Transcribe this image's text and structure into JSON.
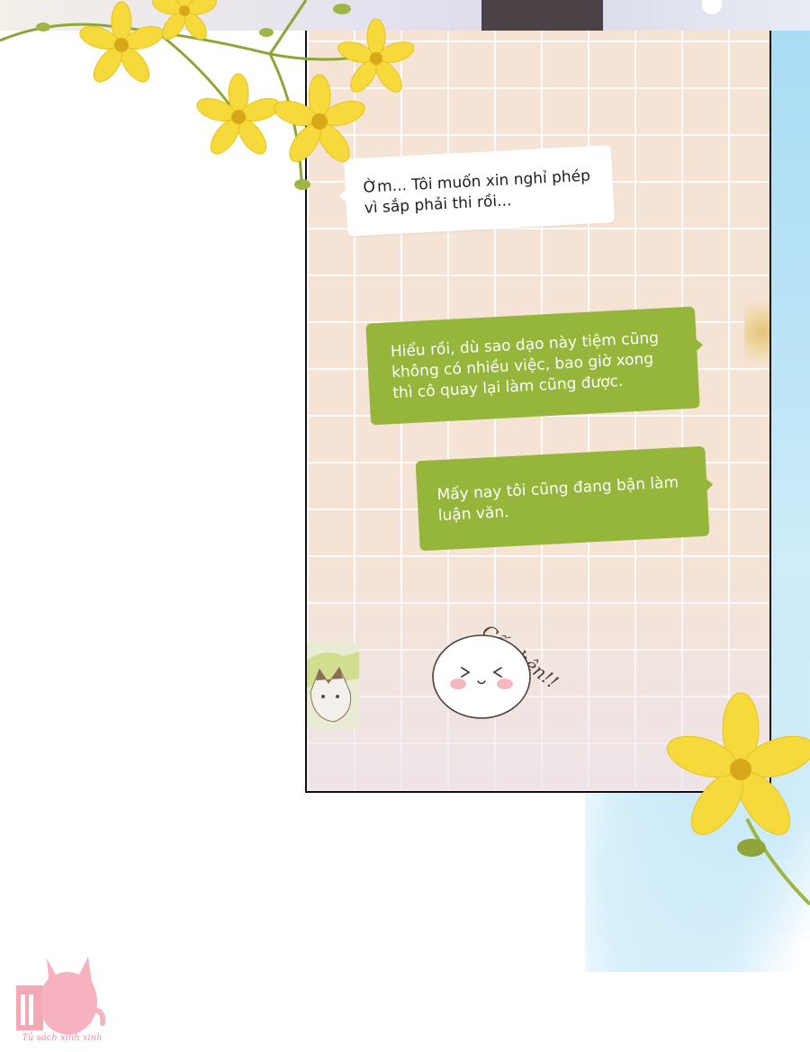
{
  "chat": {
    "messages": [
      {
        "side": "incoming",
        "text": "Ờm... Tôi muốn xin nghỉ phép\nvì sắp phải thi rồi..."
      },
      {
        "side": "outgoing",
        "text": "Hiểu rồi, dù sao dạo này tiệm cũng\nkhông có nhiều việc, bao giờ xong\nthì cô quay lại làm cũng được."
      },
      {
        "side": "outgoing",
        "text": "Mấy nay tôi cũng đang bận làm\nluận văn."
      }
    ]
  },
  "sticker": {
    "text": "Cố nhên!!"
  },
  "watermark": {
    "text": "Tủ sách xinh xinh"
  },
  "colors": {
    "outgoing_bubble": "#95b63b",
    "incoming_bubble": "#ffffff",
    "panel_bg": "#f5e4d6",
    "flower": "#f6d93a",
    "sky": "#a9dcf4"
  },
  "icons": [
    "yellow-flower-icon",
    "cat-logo-icon",
    "blob-face-icon"
  ]
}
